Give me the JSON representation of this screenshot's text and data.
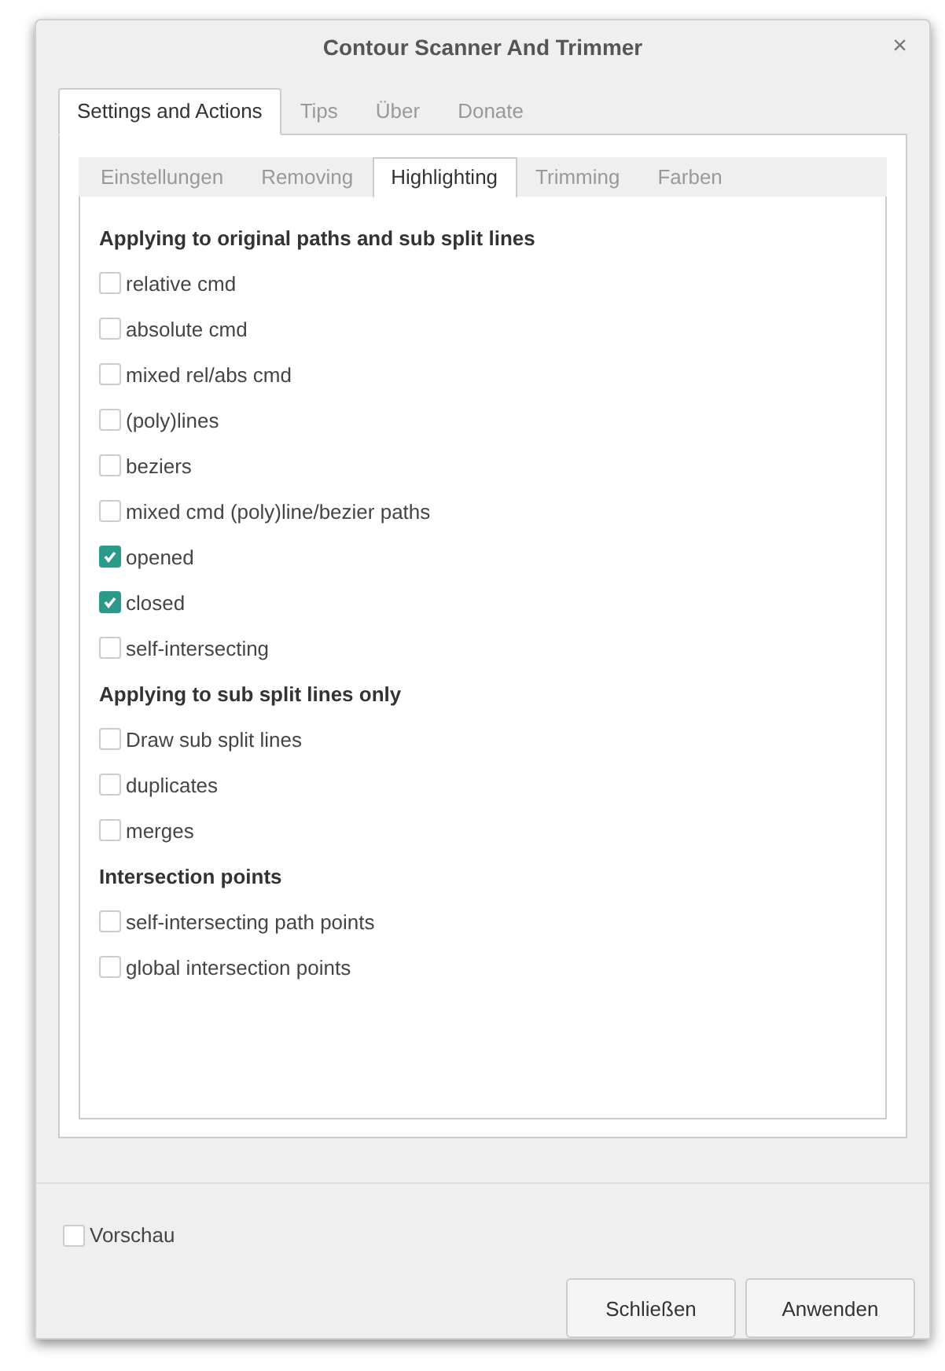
{
  "window": {
    "title": "Contour Scanner And Trimmer",
    "close": "×"
  },
  "tabs": [
    {
      "label": "Settings and Actions",
      "selected": true
    },
    {
      "label": "Tips",
      "selected": false
    },
    {
      "label": "Über",
      "selected": false
    },
    {
      "label": "Donate",
      "selected": false
    }
  ],
  "subtabs": [
    {
      "label": "Einstellungen",
      "selected": false
    },
    {
      "label": "Removing",
      "selected": false
    },
    {
      "label": "Highlighting",
      "selected": true
    },
    {
      "label": "Trimming",
      "selected": false
    },
    {
      "label": "Farben",
      "selected": false
    }
  ],
  "sections": [
    {
      "heading": "Applying to original paths and sub split lines",
      "options": [
        {
          "label": "relative cmd",
          "checked": false
        },
        {
          "label": "absolute cmd",
          "checked": false
        },
        {
          "label": "mixed rel/abs cmd",
          "checked": false
        },
        {
          "label": "(poly)lines",
          "checked": false
        },
        {
          "label": "beziers",
          "checked": false
        },
        {
          "label": "mixed cmd (poly)line/bezier paths",
          "checked": false
        },
        {
          "label": "opened",
          "checked": true
        },
        {
          "label": "closed",
          "checked": true
        },
        {
          "label": "self-intersecting",
          "checked": false
        }
      ]
    },
    {
      "heading": "Applying to sub split lines only",
      "options": [
        {
          "label": "Draw sub split lines",
          "checked": false
        },
        {
          "label": "duplicates",
          "checked": false
        },
        {
          "label": "merges",
          "checked": false
        }
      ]
    },
    {
      "heading": "Intersection points",
      "options": [
        {
          "label": "self-intersecting path points",
          "checked": false
        },
        {
          "label": "global intersection points",
          "checked": false
        }
      ]
    }
  ],
  "preview": {
    "label": "Vorschau",
    "checked": false
  },
  "buttons": [
    "Schließen",
    "Anwenden"
  ]
}
